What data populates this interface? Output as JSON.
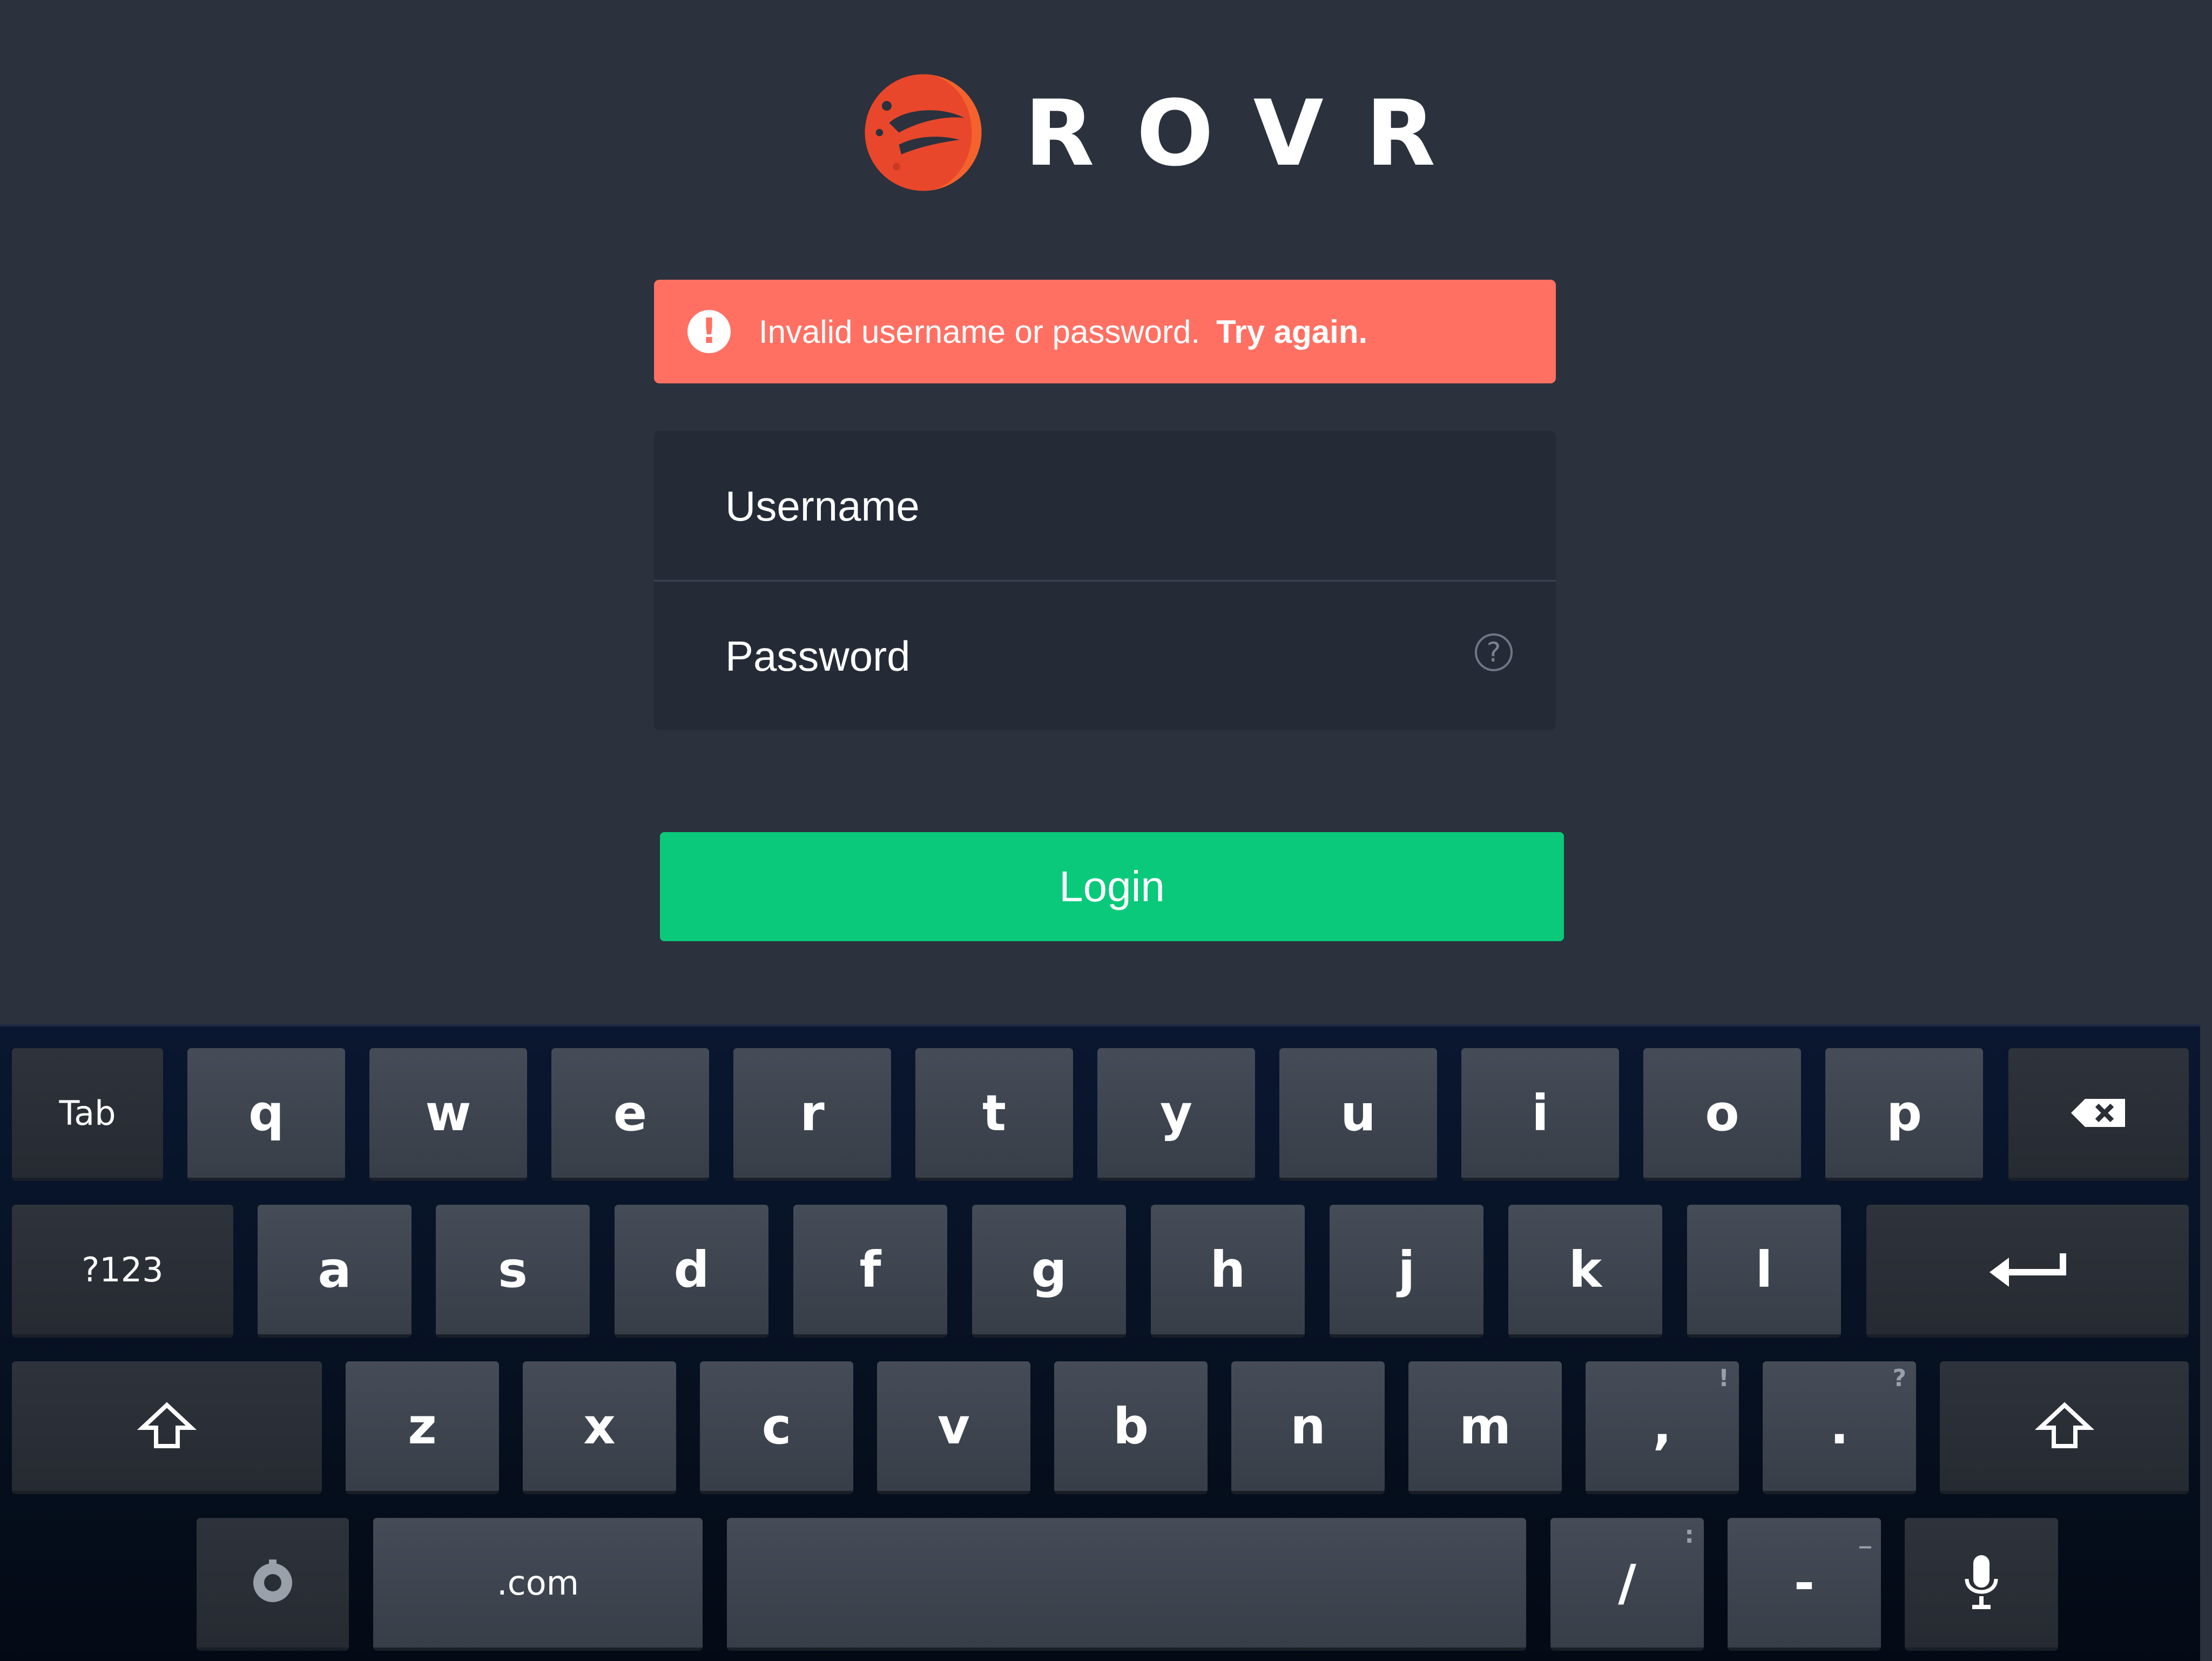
{
  "app": {
    "name": "ROVR",
    "brand_color": "#e8472b"
  },
  "error_banner": {
    "icon": "exclamation-icon",
    "icon_text": "!",
    "message": "Invalid username or password.",
    "action": "Try again.",
    "color": "#ff7063"
  },
  "form": {
    "username_placeholder": "Username",
    "password_placeholder": "Password",
    "help_icon_text": "?"
  },
  "login_button": {
    "label": "Login",
    "color": "#0ac97b"
  },
  "keyboard": {
    "row1": [
      "Tab",
      "q",
      "w",
      "e",
      "r",
      "t",
      "y",
      "u",
      "i",
      "o",
      "p",
      "backspace-icon"
    ],
    "row2": [
      "?123",
      "a",
      "s",
      "d",
      "f",
      "g",
      "h",
      "j",
      "k",
      "l",
      "enter-icon"
    ],
    "row3": [
      "shift-icon",
      "z",
      "x",
      "c",
      "v",
      "b",
      "n",
      "m",
      ",",
      ".",
      "shift-icon"
    ],
    "row3_hints": {
      "comma": "!",
      "period": "?"
    },
    "row4": [
      "settings-icon",
      ".com",
      "space",
      "/",
      "-",
      "microphone-icon"
    ],
    "row4_hints": {
      "slash": ":",
      "dash": "_"
    },
    "labels": {
      "tab": "Tab",
      "sym": "?123",
      "dotcom": ".com",
      "slash": "/",
      "dash": "-",
      "q": "q",
      "w": "w",
      "e": "e",
      "r": "r",
      "t": "t",
      "y": "y",
      "u": "u",
      "i": "i",
      "o": "o",
      "p": "p",
      "a": "a",
      "s": "s",
      "d": "d",
      "f": "f",
      "g": "g",
      "h": "h",
      "j": "j",
      "k": "k",
      "l": "l",
      "z": "z",
      "x": "x",
      "c": "c",
      "v": "v",
      "b": "b",
      "n": "n",
      "m": "m",
      "comma": ",",
      "period": "."
    }
  }
}
